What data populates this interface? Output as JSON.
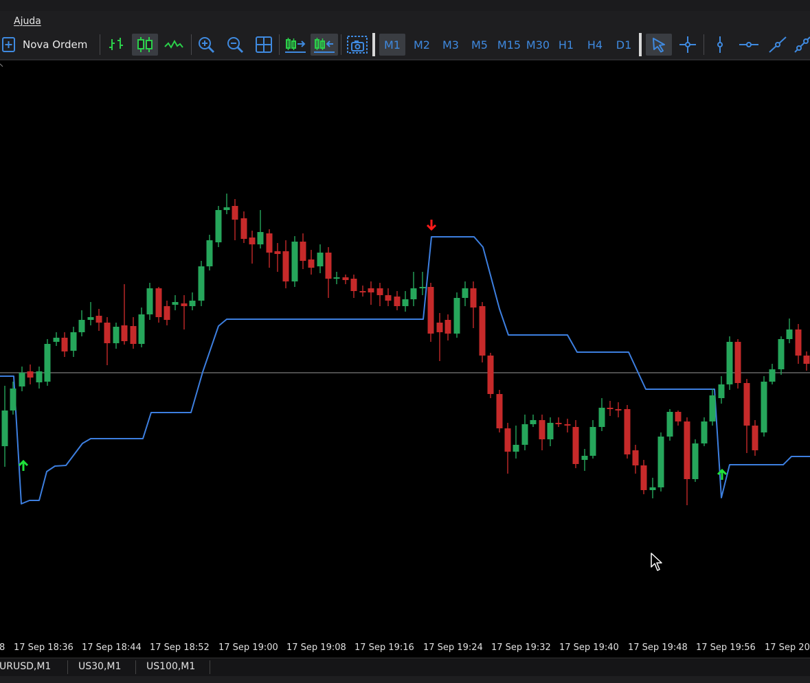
{
  "menu": {
    "help_label": "Ajuda"
  },
  "toolbar": {
    "new_order_label": "Nova Ordem",
    "timeframes": [
      "M1",
      "M2",
      "M3",
      "M5",
      "M15",
      "M30",
      "H1",
      "H4",
      "D1"
    ],
    "active_timeframe": "M1",
    "accent_color": "#3f8ae0"
  },
  "chart": {
    "symbol_tabs": [
      "URUSD,M1",
      "US30,M1",
      "US100,M1"
    ],
    "time_labels": [
      "8",
      "17 Sep 18:36",
      "17 Sep 18:44",
      "17 Sep 18:52",
      "17 Sep 19:00",
      "17 Sep 19:08",
      "17 Sep 19:16",
      "17 Sep 19:24",
      "17 Sep 19:32",
      "17 Sep 19:40",
      "17 Sep 19:48",
      "17 Sep 19:56",
      "17 Sep 20"
    ],
    "colors": {
      "bull": "#26a65b",
      "bear": "#c62a2a",
      "trail": "#3d7fe0",
      "hline": "#9a9a9a",
      "up_arrow": "#1fe13a",
      "down_arrow": "#ff1a1a"
    }
  }
}
